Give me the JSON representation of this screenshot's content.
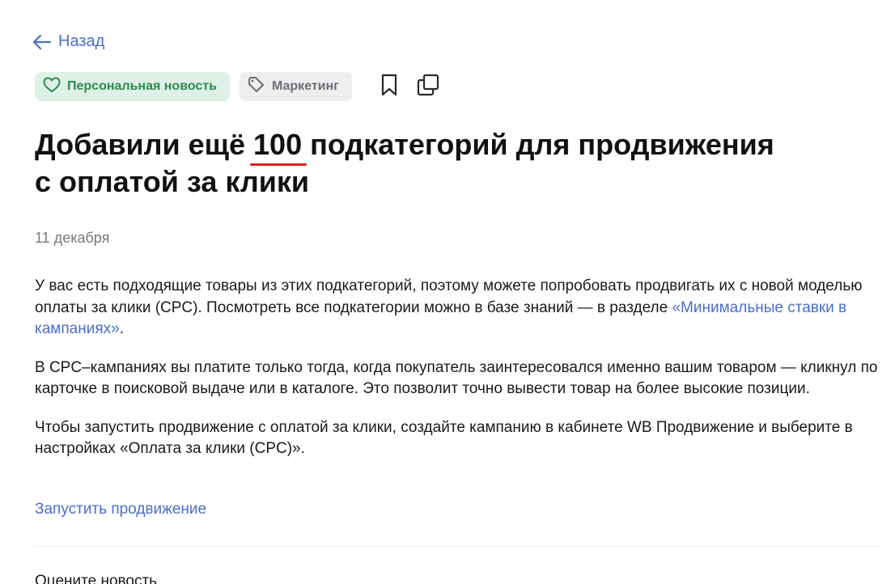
{
  "nav": {
    "back_label": "Назад"
  },
  "tags": {
    "personal_label": "Персональная новость",
    "marketing_label": "Маркетинг"
  },
  "article": {
    "title_part1": "Добавили ещё ",
    "title_highlight": "100",
    "title_part2": " подкатегорий для продвижения",
    "title_line2": "с оплатой за клики",
    "date": "11 декабря",
    "p1_text": "У вас есть подходящие товары из этих подкатегорий, поэтому можете попробовать продвигать их с новой моделью оплаты за клики (CPC). Посмотреть все подкатегории можно в базе знаний — в разделе ",
    "p1_link": "«Минимальные ставки в кампаниях»",
    "p1_end": ".",
    "p2_text": "В CPC–кампаниях вы платите только тогда, когда покупатель заинтересовался именно вашим товаром — кликнул по карточке в поисковой выдаче или в каталоге. Это позволит точно вывести товар на более высокие позиции.",
    "p3_text": "Чтобы запустить продвижение с оплатой за клики, создайте кампанию в кабинете WB Продвижение и выберите в настройках «Оплата за клики (CPC)».",
    "cta_label": "Запустить продвижение",
    "rate_label": "Оцените новость"
  },
  "colors": {
    "link": "#4a6fc9",
    "personal_tag_bg": "#def1e6",
    "personal_tag_text": "#2f8a4f",
    "marketing_tag_bg": "#eeeeef",
    "marketing_tag_text": "#6b6e75",
    "highlight_underline": "#d9251d"
  },
  "icons": {
    "back": "arrow-left-icon",
    "personal": "heart-icon",
    "marketing": "tag-icon",
    "bookmark": "bookmark-icon",
    "copy": "copy-icon"
  }
}
